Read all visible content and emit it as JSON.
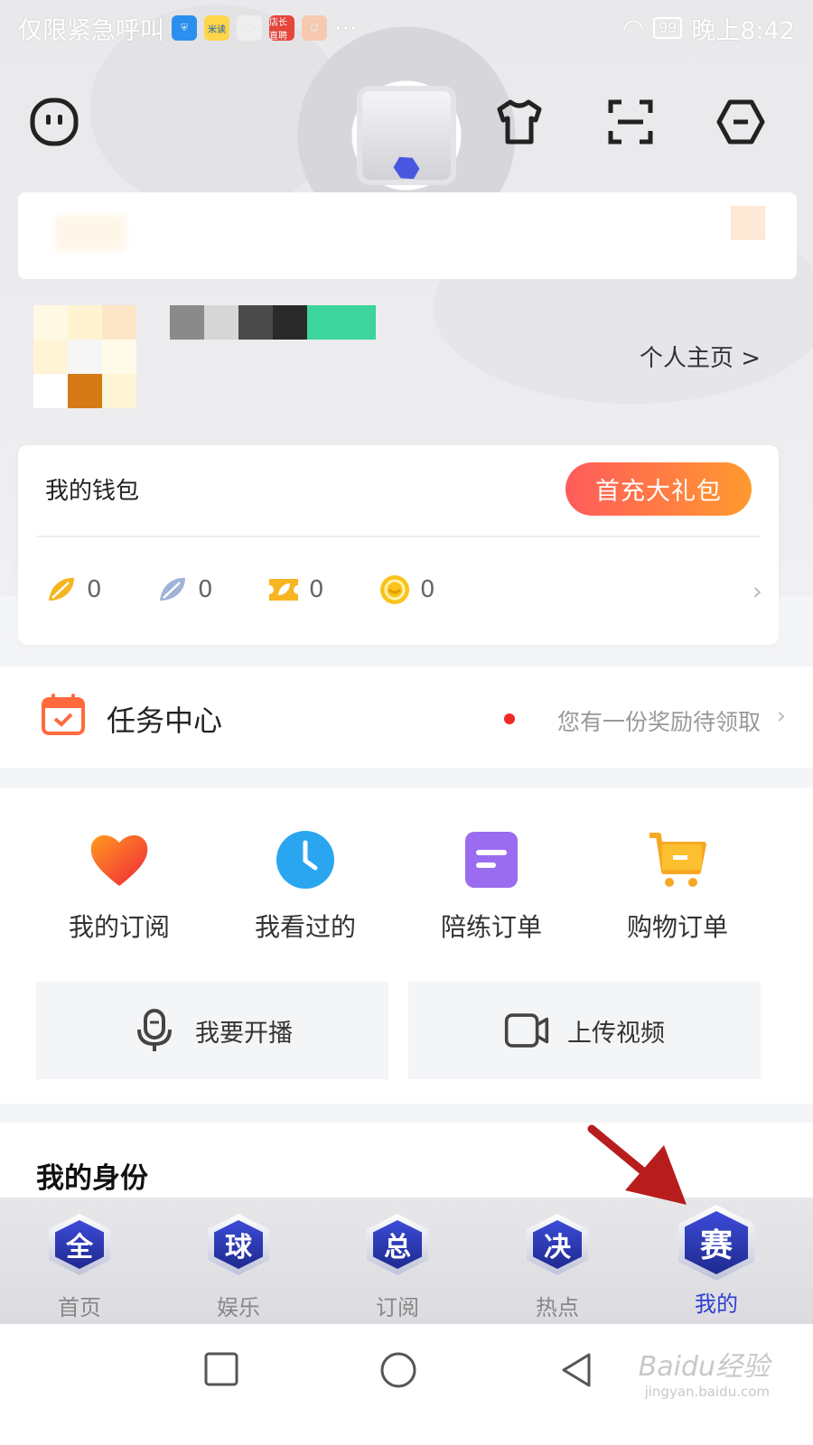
{
  "status_bar": {
    "carrier": "仅限紧急呼叫",
    "apps": [
      "米读",
      "店长直聘"
    ],
    "battery": "99",
    "time": "晚上8:42"
  },
  "toolbar": {
    "icons": [
      "chat-face-icon",
      "tshirt-icon",
      "scan-icon",
      "settings-hex-icon"
    ]
  },
  "profile": {
    "link": "个人主页 >"
  },
  "wallet": {
    "title": "我的钱包",
    "gift_button": "首充大礼包",
    "balances": [
      {
        "icon": "gold-leaf-icon",
        "value": "0"
      },
      {
        "icon": "silver-leaf-icon",
        "value": "0"
      },
      {
        "icon": "ticket-icon",
        "value": "0"
      },
      {
        "icon": "coin-icon",
        "value": "0"
      }
    ]
  },
  "task_center": {
    "title": "任务中心",
    "notice": "您有一份奖励待领取"
  },
  "quick_actions": [
    {
      "label": "我的订阅",
      "icon": "heart-icon"
    },
    {
      "label": "我看过的",
      "icon": "clock-icon"
    },
    {
      "label": "陪练订单",
      "icon": "order-note-icon"
    },
    {
      "label": "购物订单",
      "icon": "cart-icon"
    }
  ],
  "big_buttons": [
    {
      "label": "我要开播",
      "icon": "microphone-icon"
    },
    {
      "label": "上传视频",
      "icon": "video-camera-icon"
    }
  ],
  "identity": {
    "title": "我的身份"
  },
  "tabs": [
    {
      "label": "首页",
      "glyph": "全",
      "active": false
    },
    {
      "label": "娱乐",
      "glyph": "球",
      "active": false
    },
    {
      "label": "订阅",
      "glyph": "总",
      "active": false
    },
    {
      "label": "热点",
      "glyph": "决",
      "active": false
    },
    {
      "label": "我的",
      "glyph": "赛",
      "active": true
    }
  ],
  "watermark": {
    "brand": "Baidu经验",
    "url": "jingyan.baidu.com"
  },
  "colors": {
    "accent": "#2f3fd0",
    "gift_start": "#ff5b5b",
    "gift_end": "#ff9a2e",
    "notice_dot": "#f02828",
    "annotation_arrow": "#b81d1d"
  }
}
